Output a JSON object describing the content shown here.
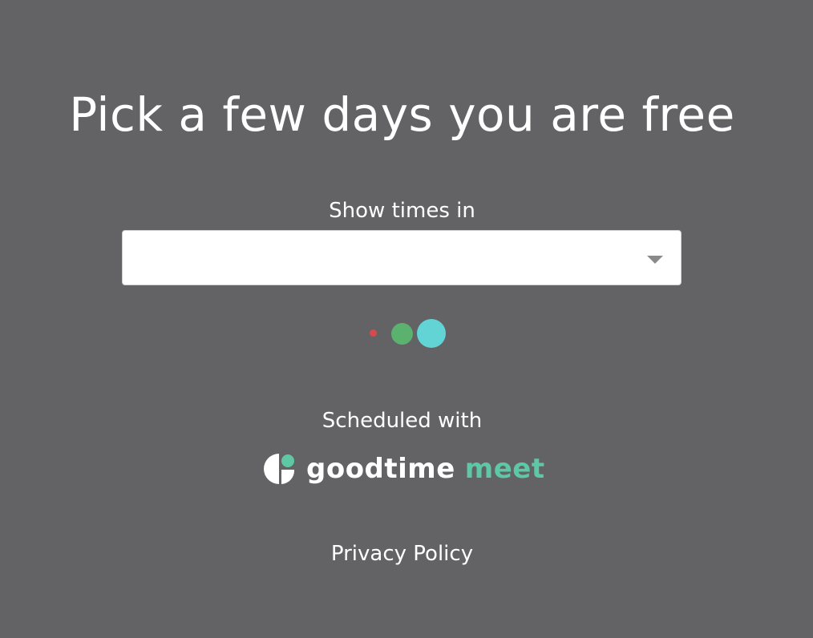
{
  "heading": "Pick a few days you are free",
  "timezone": {
    "label": "Show times in",
    "selected_value": "",
    "options": []
  },
  "loader": {
    "dot_colors": [
      "#d9484a",
      "#5ab26e",
      "#62d4d6"
    ]
  },
  "footer": {
    "scheduled_with": "Scheduled with",
    "brand_word1": "goodtime",
    "brand_word2": "meet",
    "brand_colors": {
      "primary": "#ffffff",
      "accent": "#5ec7a4"
    },
    "privacy_policy": "Privacy Policy"
  },
  "colors": {
    "background": "#636365",
    "select_background": "#ffffff",
    "select_caret": "#8a8a8a"
  }
}
